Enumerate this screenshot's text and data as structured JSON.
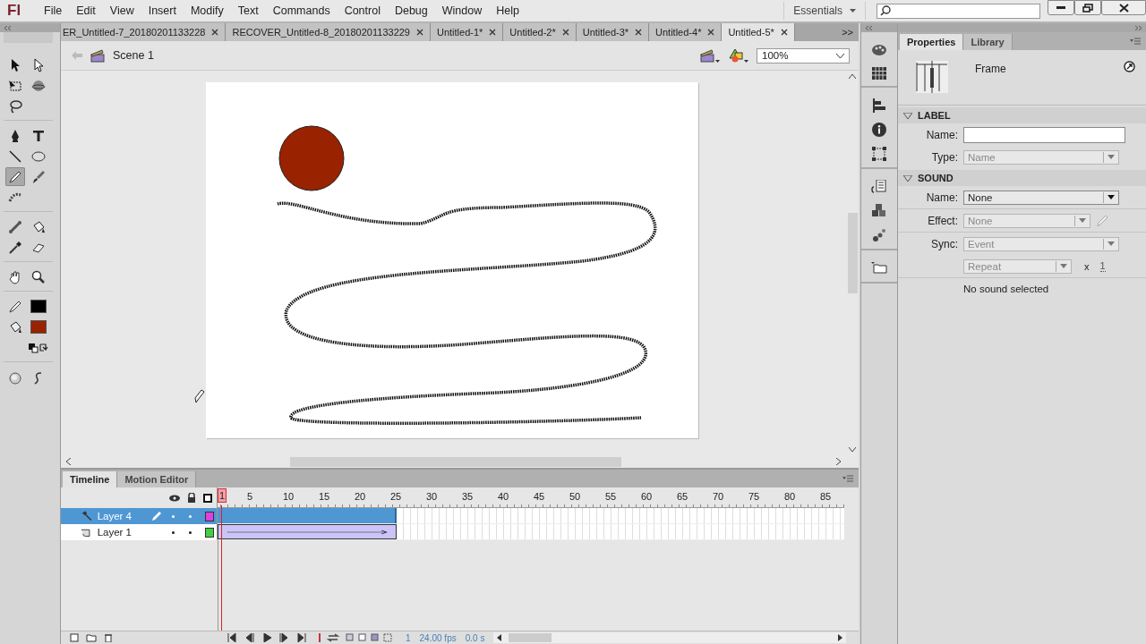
{
  "app": {
    "logo": "Fl",
    "menus": [
      "File",
      "Edit",
      "View",
      "Insert",
      "Modify",
      "Text",
      "Commands",
      "Control",
      "Debug",
      "Window",
      "Help"
    ],
    "workspace": "Essentials"
  },
  "tabs": [
    {
      "label": "ER_Untitled-7_20180201133228",
      "selected": false
    },
    {
      "label": "RECOVER_Untitled-8_20180201133229",
      "selected": false
    },
    {
      "label": "Untitled-1*",
      "selected": false
    },
    {
      "label": "Untitled-2*",
      "selected": false
    },
    {
      "label": "Untitled-3*",
      "selected": false
    },
    {
      "label": "Untitled-4*",
      "selected": false
    },
    {
      "label": "Untitled-5*",
      "selected": true
    }
  ],
  "tabs_overflow": ">>",
  "edit_bar": {
    "scene": "Scene 1",
    "zoom": "100%"
  },
  "tools": [
    {
      "kind": "selection",
      "selected": false
    },
    {
      "kind": "subselection",
      "selected": false
    },
    {
      "kind": "transform",
      "selected": false
    },
    {
      "kind": "rotation",
      "selected": false
    },
    {
      "kind": "lasso",
      "selected": false
    },
    {
      "kind": "pen",
      "selected": false
    },
    {
      "kind": "text",
      "selected": false
    },
    {
      "kind": "line",
      "selected": false
    },
    {
      "kind": "oval",
      "selected": false
    },
    {
      "kind": "pencil",
      "selected": true
    },
    {
      "kind": "brush",
      "selected": false
    },
    {
      "kind": "deco",
      "selected": false
    },
    {
      "kind": "bone",
      "selected": false
    },
    {
      "kind": "bucket",
      "selected": false
    },
    {
      "kind": "eyedropper",
      "selected": false
    },
    {
      "kind": "eraser",
      "selected": false
    },
    {
      "kind": "hand",
      "selected": false
    },
    {
      "kind": "zoom",
      "selected": false
    }
  ],
  "swatches": [
    {
      "kind": "stroke",
      "color": "#000000"
    },
    {
      "kind": "fill",
      "color": "#992200"
    }
  ],
  "properties": {
    "tabs": [
      {
        "label": "Properties",
        "selected": true
      },
      {
        "label": "Library",
        "selected": false
      }
    ],
    "target": "Frame",
    "sections": [
      {
        "title": "LABEL",
        "expanded": true,
        "rows": [
          {
            "label": "Name:",
            "kind": "input"
          },
          {
            "label": "Type:",
            "kind": "select",
            "value": "Name",
            "disabled": true
          }
        ]
      },
      {
        "title": "SOUND",
        "expanded": true,
        "rows": [
          {
            "label": "Name:",
            "kind": "select",
            "value": "None",
            "disabled": false
          },
          {
            "label": "Effect:",
            "kind": "select",
            "value": "None",
            "disabled": true
          },
          {
            "label": "Sync:",
            "kind": "select",
            "value": "Event",
            "disabled": true
          },
          {
            "label": "",
            "kind": "repeat",
            "value": "Repeat",
            "disabled": true,
            "times_label": "x",
            "times": "1"
          }
        ]
      }
    ],
    "status": "No sound selected"
  },
  "timeline": {
    "tabs": [
      {
        "label": "Timeline",
        "selected": true
      },
      {
        "label": "Motion Editor",
        "selected": false
      }
    ],
    "ruler": [
      "1",
      "5",
      "10",
      "15",
      "20",
      "25",
      "30",
      "35",
      "40",
      "45",
      "50",
      "55",
      "60",
      "65",
      "70",
      "75",
      "80",
      "85"
    ],
    "layers": [
      {
        "name": "Layer 4",
        "kind": "guide",
        "selected": true,
        "editing": true,
        "color": "#e040e0",
        "level": 0.285
      },
      {
        "name": "Layer 1",
        "kind": "guided",
        "selected": false,
        "editing": false,
        "color": "#40d040",
        "level": 0.285
      }
    ],
    "frame": "1",
    "fps": "24.00 fps",
    "time": "0.0 s"
  }
}
